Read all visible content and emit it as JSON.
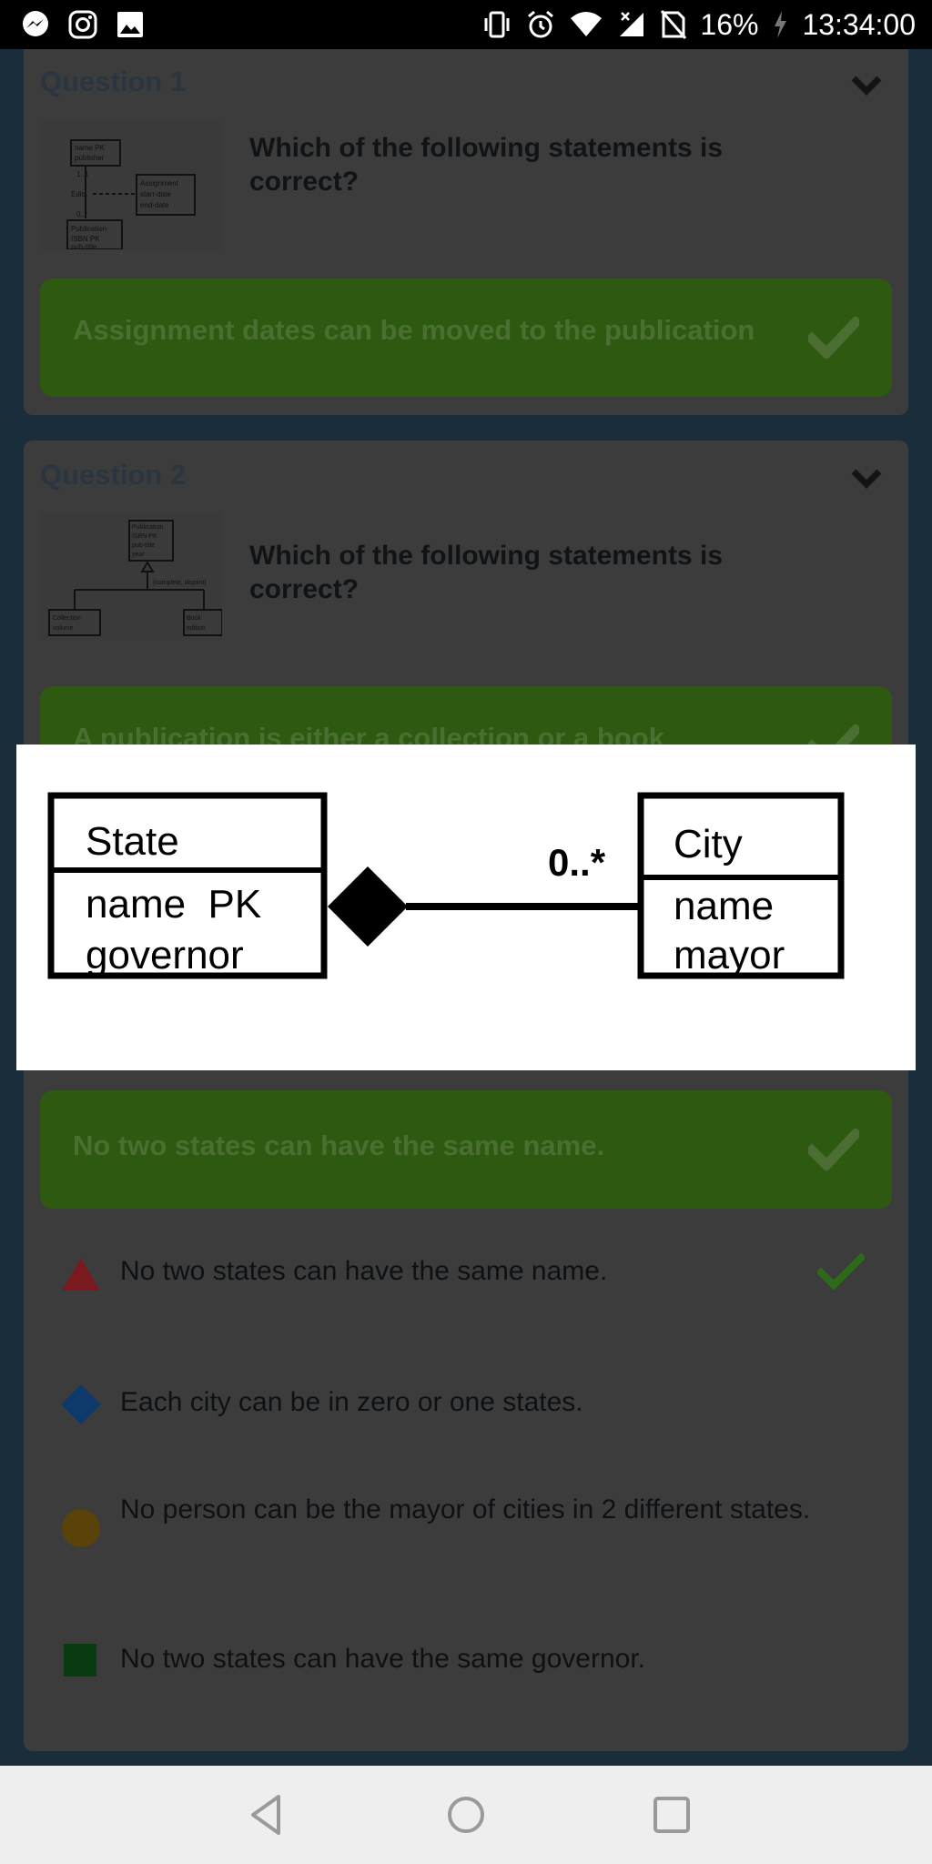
{
  "status_bar": {
    "battery": "16%",
    "time": "13:34:00",
    "icons": [
      "messenger-icon",
      "instagram-icon",
      "gallery-icon",
      "vibrate-icon",
      "alarm-icon",
      "wifi-icon",
      "no-signal-icon",
      "no-sim-icon",
      "charging-icon"
    ]
  },
  "cards": [
    {
      "title": "Question 1",
      "question": "Which of the following statements is correct?",
      "answer": "Assignment dates can be moved to the publication",
      "thumbnail": {
        "boxes": [
          {
            "lines": [
              "name PK",
              "publisher"
            ]
          },
          {
            "lines": [
              "Assignment",
              "start-date",
              "end-date"
            ]
          },
          {
            "lines": [
              "Publication",
              "ISBN PK",
              "pub-title"
            ]
          }
        ],
        "labels": [
          "1..1",
          "Edits",
          "0..*"
        ]
      }
    },
    {
      "title": "Question 2",
      "question": "Which of the following statements is correct?",
      "answer": "A publication is either a collection or a book",
      "thumbnail": {
        "boxes": [
          {
            "lines": [
              "Publication",
              "ISBN PK",
              "pub-title",
              "year"
            ]
          },
          {
            "lines": [
              "Collection",
              "volume"
            ]
          },
          {
            "lines": [
              "Book",
              "edition"
            ]
          }
        ],
        "labels": [
          "{complete, disjoint}"
        ]
      }
    },
    {
      "answer": "No two states can have the same name.",
      "options": [
        {
          "text": "No two states can have the same name.",
          "shape": "triangle-icon",
          "color": "#7a1a1f",
          "correct": true
        },
        {
          "text": "Each city can be in zero or one states.",
          "shape": "diamond-icon",
          "color": "#0e3a6b",
          "correct": false
        },
        {
          "text": "No person can be the mayor of cities in 2 different states.",
          "shape": "circle-icon",
          "color": "#5a4308",
          "correct": false
        },
        {
          "text": "No two states can have the same governor.",
          "shape": "square-icon",
          "color": "#0a3a10",
          "correct": false
        }
      ]
    }
  ],
  "diagram": {
    "left_class": {
      "name": "State",
      "attributes": [
        "name  PK",
        "governor"
      ]
    },
    "right_class": {
      "name": "City",
      "attributes": [
        "name",
        "mayor"
      ]
    },
    "multiplicity": "0..*"
  },
  "colors": {
    "answer_bar": "#2d5a10",
    "check_green": "#2f6a1a",
    "card": "#3c3c3c"
  },
  "nav_bar": [
    "back-icon",
    "home-icon",
    "recents-icon"
  ]
}
